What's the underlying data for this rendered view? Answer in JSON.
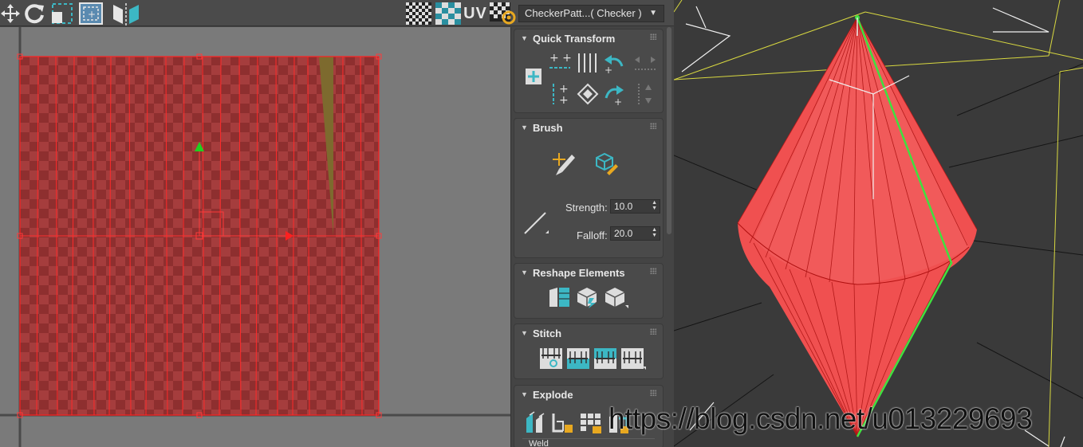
{
  "toolbar": {
    "uv_label": "UV",
    "texture_dropdown": "CheckerPatt...( Checker )"
  },
  "panel": {
    "rollouts": [
      {
        "title": "Quick Transform"
      },
      {
        "title": "Brush"
      },
      {
        "title": "Reshape Elements"
      },
      {
        "title": "Stitch"
      },
      {
        "title": "Explode"
      }
    ],
    "brush": {
      "strength_label": "Strength:",
      "strength_value": "10.0",
      "falloff_label": "Falloff:",
      "falloff_value": "20.0"
    },
    "explode": {
      "weld_label": "Weld"
    }
  },
  "watermark": "https://blog.csdn.net/u013229693",
  "colors": {
    "background": "#7a7a7a",
    "uv_fill": "#a33a3a",
    "accent_teal": "#3cb7c4",
    "selection_red": "#ff2020",
    "mesh_red": "#f04848",
    "wire_yellow": "#d8d840",
    "edge_green": "#40e040"
  }
}
